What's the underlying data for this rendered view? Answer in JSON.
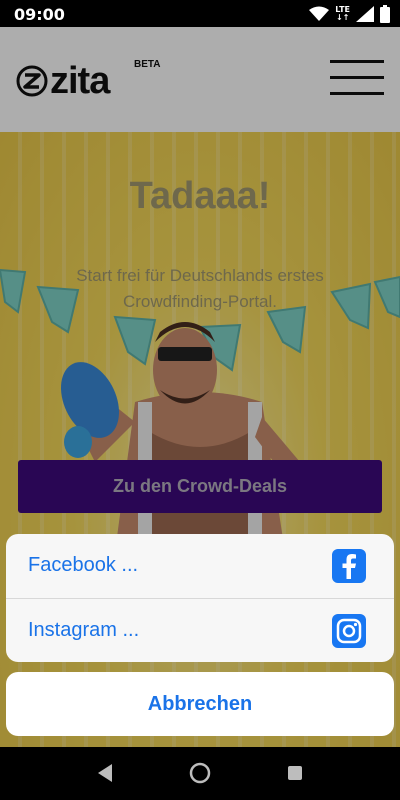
{
  "status_bar": {
    "time": "09:00",
    "network": "LTE"
  },
  "header": {
    "logo_text": "zita",
    "beta_label": "BETA",
    "menu_icon": "hamburger-icon"
  },
  "hero": {
    "title": "Tadaaa!",
    "subtitle": "Start frei für Deutschlands erstes Crowdfinding-Portal.",
    "cta_label": "Zu den Crowd-Deals"
  },
  "share_sheet": {
    "options": [
      {
        "label": "Facebook ...",
        "icon": "facebook-icon"
      },
      {
        "label": "Instagram ...",
        "icon": "instagram-icon"
      }
    ],
    "cancel_label": "Abbrechen"
  },
  "colors": {
    "accent": "#1a73e8",
    "cta_bg": "#3d0a7d",
    "icon_blue": "#1877f2"
  }
}
